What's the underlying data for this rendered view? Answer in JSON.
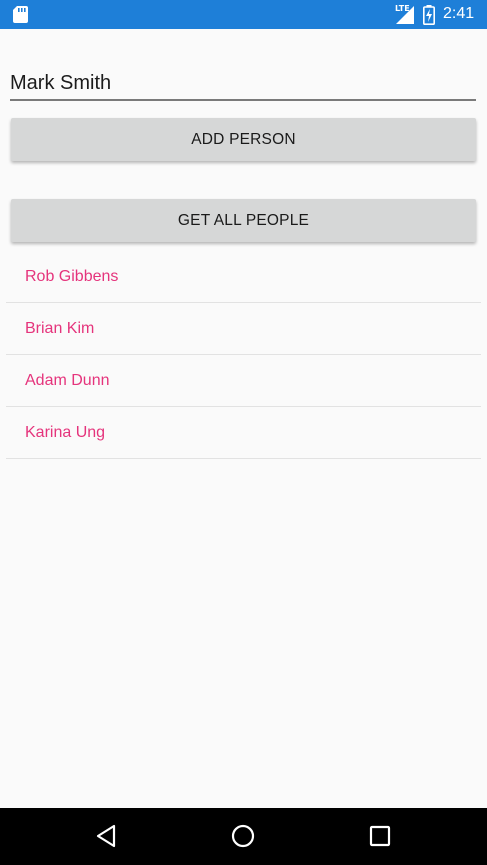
{
  "status_bar": {
    "time": "2:41",
    "network_label": "LTE",
    "icons": [
      "sd-card-icon",
      "signal-icon",
      "battery-charging-icon"
    ],
    "background_color": "#1e7fd8"
  },
  "entry": {
    "value": "Mark Smith"
  },
  "buttons": {
    "add_person": "ADD PERSON",
    "get_all_people": "GET ALL PEOPLE"
  },
  "people": [
    {
      "name": "Rob Gibbens"
    },
    {
      "name": "Brian Kim"
    },
    {
      "name": "Adam Dunn"
    },
    {
      "name": "Karina Ung"
    }
  ],
  "colors": {
    "accent": "#e5347c",
    "button_bg": "#d6d7d7",
    "page_bg": "#fafafa"
  },
  "nav_bar": {
    "icons": [
      "back-icon",
      "home-icon",
      "recent-apps-icon"
    ]
  }
}
